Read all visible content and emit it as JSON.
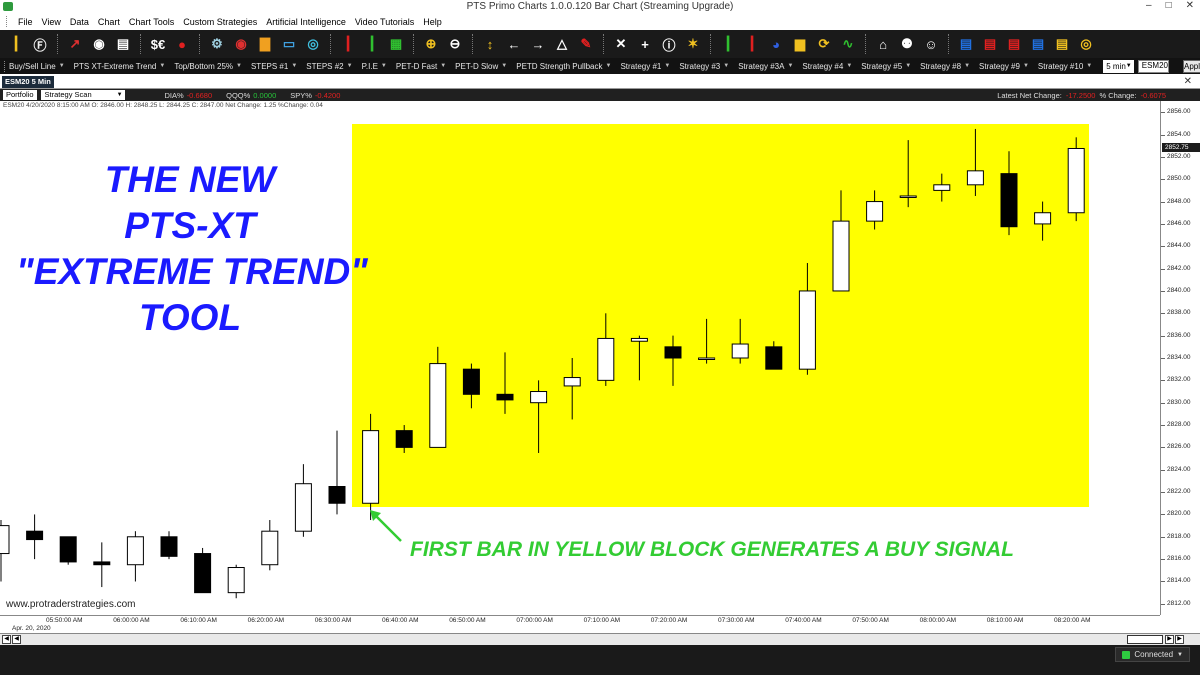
{
  "window": {
    "title": "PTS Primo Charts 1.0.0.120  Bar Chart (Streaming Upgrade)",
    "controls": [
      "–",
      "□",
      "✕"
    ]
  },
  "menu": [
    "File",
    "View",
    "Data",
    "Chart",
    "Chart Tools",
    "Custom Strategies",
    "Artificial Intelligence",
    "Video Tutorials",
    "Help"
  ],
  "toolbar_icons": [
    {
      "name": "bar-chart-icon",
      "glyph": "┃",
      "color": "#f0c020"
    },
    {
      "name": "f-icon",
      "glyph": "Ⓕ",
      "color": "#f0f0f0"
    },
    {
      "name": "arrows-icon",
      "glyph": "↗",
      "color": "#e03030"
    },
    {
      "name": "eye-icon",
      "glyph": "◉",
      "color": "#ffffff"
    },
    {
      "name": "table-icon",
      "glyph": "▤",
      "color": "#ffffff"
    },
    {
      "name": "currency-icon",
      "glyph": "$€",
      "color": "#ffffff"
    },
    {
      "name": "stop-icon",
      "glyph": "●",
      "color": "#e02020"
    },
    {
      "name": "robot-icon",
      "glyph": "⚙",
      "color": "#9ecfe0"
    },
    {
      "name": "eye-red-icon",
      "glyph": "◉",
      "color": "#e03030"
    },
    {
      "name": "chart-bars-icon",
      "glyph": "▇",
      "color": "#f0a020"
    },
    {
      "name": "monitor-icon",
      "glyph": "▭",
      "color": "#40a0e0"
    },
    {
      "name": "power-icon",
      "glyph": "◎",
      "color": "#40c0e0"
    },
    {
      "name": "candle-red-icon",
      "glyph": "┃",
      "color": "#e02020"
    },
    {
      "name": "candle-green-icon",
      "glyph": "┃",
      "color": "#30c030"
    },
    {
      "name": "grid-icon",
      "glyph": "▦",
      "color": "#30c030"
    },
    {
      "name": "zoom-in-icon",
      "glyph": "⊕",
      "color": "#f0c020"
    },
    {
      "name": "zoom-out-icon",
      "glyph": "⊖",
      "color": "#ffffff"
    },
    {
      "name": "pan-icon",
      "glyph": "↕",
      "color": "#f0c020"
    },
    {
      "name": "left-arrow-icon",
      "glyph": "←",
      "color": "#ffffff"
    },
    {
      "name": "right-arrow-icon",
      "glyph": "→",
      "color": "#ffffff"
    },
    {
      "name": "mountain-icon",
      "glyph": "△",
      "color": "#ffffff"
    },
    {
      "name": "pen-icon",
      "glyph": "✎",
      "color": "#e02020"
    },
    {
      "name": "cross-icon",
      "glyph": "✕",
      "color": "#ffffff"
    },
    {
      "name": "crosshair-icon",
      "glyph": "+",
      "color": "#ffffff"
    },
    {
      "name": "info-icon",
      "glyph": "ⓘ",
      "color": "#ffffff"
    },
    {
      "name": "star-icon",
      "glyph": "✶",
      "color": "#f0c020"
    },
    {
      "name": "candles-green-icon",
      "glyph": "┃",
      "color": "#30c030"
    },
    {
      "name": "candles-mixed-icon",
      "glyph": "┃",
      "color": "#e02020"
    },
    {
      "name": "pie-icon",
      "glyph": "◕",
      "color": "#3060e0"
    },
    {
      "name": "layout-icon",
      "glyph": "▆",
      "color": "#f0c020"
    },
    {
      "name": "refresh-icon",
      "glyph": "⟳",
      "color": "#f0c020"
    },
    {
      "name": "wave-icon",
      "glyph": "∿",
      "color": "#30c030"
    },
    {
      "name": "home-icon",
      "glyph": "⌂",
      "color": "#ffffff"
    },
    {
      "name": "users-icon",
      "glyph": "⚉",
      "color": "#ffffff"
    },
    {
      "name": "user-icon",
      "glyph": "☺",
      "color": "#ffffff"
    },
    {
      "name": "book-1-icon",
      "glyph": "▤",
      "color": "#2070e0"
    },
    {
      "name": "book-2-icon",
      "glyph": "▤",
      "color": "#e02020"
    },
    {
      "name": "book-3-icon",
      "glyph": "▤",
      "color": "#e02020"
    },
    {
      "name": "book-4-icon",
      "glyph": "▤",
      "color": "#2070e0"
    },
    {
      "name": "book-5-icon",
      "glyph": "▤",
      "color": "#f0c020"
    },
    {
      "name": "cd-icon",
      "glyph": "◎",
      "color": "#f0c020"
    }
  ],
  "strategy_bar": {
    "items": [
      "Buy/Sell Line",
      "PTS XT-Extreme Trend",
      "Top/Bottom 25%",
      "STEPS #1",
      "STEPS #2",
      "P.I.E",
      "PET-D Fast",
      "PET-D Slow",
      "PETD Strength Pullback",
      "Strategy #1",
      "Strategy #3",
      "Strategy #3A",
      "Strategy #4",
      "Strategy #5",
      "Strategy #8",
      "Strategy #9",
      "Strategy #10"
    ],
    "interval": "5 min",
    "symbol": "ESM20",
    "apply_label": "Apply"
  },
  "chart_tab": {
    "label": "ESM20 5 Min",
    "close": "✕"
  },
  "info_bar": {
    "portfolio": "Portfolio",
    "strategy_scan": "Strategy Scan",
    "tickers": [
      {
        "name": "DIA%",
        "value": "-0.6680",
        "color": "#e02020"
      },
      {
        "name": "QQQ%",
        "value": "0.0000",
        "color": "#27c23a"
      },
      {
        "name": "SPY%",
        "value": "-0.4200",
        "color": "#e02020"
      }
    ],
    "net_change_label": "Latest Net Change:",
    "net_change_value": "-17.2500",
    "pct_change_label": "% Change:",
    "pct_change_value": "-0.6075"
  },
  "bar_details": "ESM20 4/20/2020 8:15:00 AM O: 2846.00 H: 2848.25 L: 2844.25 C: 2847.00 Net Change: 1.25  %Change: 0.04",
  "overlay": {
    "headline_lines": [
      "THE NEW",
      "PTS-XT",
      "\"EXTREME TREND\"",
      "TOOL"
    ],
    "signal_text": "FIRST BAR IN YELLOW BLOCK GENERATES A BUY SIGNAL",
    "website": "www.protraderstrategies.com",
    "headline_color": "#1a1aff",
    "signal_color": "#33cc33",
    "highlight_color": "#ffff00"
  },
  "price_axis": {
    "labels": [
      "2856.00",
      "2854.00",
      "2852.00",
      "2850.00",
      "2848.00",
      "2846.00",
      "2844.00",
      "2842.00",
      "2840.00",
      "2838.00",
      "2836.00",
      "2834.00",
      "2832.00",
      "2830.00",
      "2828.00",
      "2826.00",
      "2824.00",
      "2822.00",
      "2820.00",
      "2818.00",
      "2816.00",
      "2814.00",
      "2812.00"
    ],
    "last_price": "2852.75"
  },
  "time_axis": {
    "labels": [
      "05:50:00 AM",
      "06:00:00 AM",
      "06:10:00 AM",
      "06:20:00 AM",
      "06:30:00 AM",
      "06:40:00 AM",
      "06:50:00 AM",
      "07:00:00 AM",
      "07:10:00 AM",
      "07:20:00 AM",
      "07:30:00 AM",
      "07:40:00 AM",
      "07:50:00 AM",
      "08:00:00 AM",
      "08:10:00 AM",
      "08:20:00 AM"
    ],
    "date": "Apr. 20, 2020"
  },
  "status": {
    "connected": "Connected"
  },
  "chart_data": {
    "type": "candlestick",
    "symbol": "ESM20",
    "interval": "5 min",
    "ylim": [
      2811,
      2857
    ],
    "candles": [
      {
        "o": 2816.5,
        "h": 2819.5,
        "l": 2814.0,
        "c": 2819.0
      },
      {
        "o": 2818.5,
        "h": 2820.0,
        "l": 2816.0,
        "c": 2817.75
      },
      {
        "o": 2818.0,
        "h": 2818.0,
        "l": 2815.5,
        "c": 2815.75
      },
      {
        "o": 2815.75,
        "h": 2817.5,
        "l": 2813.5,
        "c": 2815.5
      },
      {
        "o": 2815.5,
        "h": 2818.5,
        "l": 2814.0,
        "c": 2818.0
      },
      {
        "o": 2818.0,
        "h": 2818.5,
        "l": 2816.0,
        "c": 2816.25
      },
      {
        "o": 2816.5,
        "h": 2817.0,
        "l": 2813.0,
        "c": 2813.0
      },
      {
        "o": 2813.0,
        "h": 2815.5,
        "l": 2812.5,
        "c": 2815.25
      },
      {
        "o": 2815.5,
        "h": 2819.5,
        "l": 2815.0,
        "c": 2818.5
      },
      {
        "o": 2818.5,
        "h": 2824.5,
        "l": 2818.0,
        "c": 2822.75
      },
      {
        "o": 2822.5,
        "h": 2827.5,
        "l": 2820.0,
        "c": 2821.0
      },
      {
        "o": 2821.0,
        "h": 2829.0,
        "l": 2819.5,
        "c": 2827.5
      },
      {
        "o": 2827.5,
        "h": 2828.0,
        "l": 2825.5,
        "c": 2826.0
      },
      {
        "o": 2826.0,
        "h": 2835.0,
        "l": 2826.0,
        "c": 2833.5
      },
      {
        "o": 2833.0,
        "h": 2833.5,
        "l": 2829.5,
        "c": 2830.75
      },
      {
        "o": 2830.75,
        "h": 2834.5,
        "l": 2829.0,
        "c": 2830.25
      },
      {
        "o": 2830.0,
        "h": 2832.0,
        "l": 2825.5,
        "c": 2831.0
      },
      {
        "o": 2831.5,
        "h": 2834.0,
        "l": 2828.5,
        "c": 2832.25
      },
      {
        "o": 2832.0,
        "h": 2838.0,
        "l": 2831.5,
        "c": 2835.75
      },
      {
        "o": 2835.5,
        "h": 2836.0,
        "l": 2832.0,
        "c": 2835.75
      },
      {
        "o": 2835.0,
        "h": 2836.0,
        "l": 2831.5,
        "c": 2834.0
      },
      {
        "o": 2834.0,
        "h": 2837.5,
        "l": 2833.5,
        "c": 2834.0
      },
      {
        "o": 2834.0,
        "h": 2837.5,
        "l": 2833.5,
        "c": 2835.25
      },
      {
        "o": 2835.0,
        "h": 2835.5,
        "l": 2833.0,
        "c": 2833.0
      },
      {
        "o": 2833.0,
        "h": 2842.5,
        "l": 2832.5,
        "c": 2840.0
      },
      {
        "o": 2840.0,
        "h": 2849.0,
        "l": 2840.0,
        "c": 2846.25
      },
      {
        "o": 2846.25,
        "h": 2849.0,
        "l": 2845.5,
        "c": 2848.0
      },
      {
        "o": 2848.5,
        "h": 2853.5,
        "l": 2847.5,
        "c": 2848.5
      },
      {
        "o": 2849.0,
        "h": 2850.5,
        "l": 2848.0,
        "c": 2849.5
      },
      {
        "o": 2849.5,
        "h": 2854.5,
        "l": 2848.5,
        "c": 2850.75
      },
      {
        "o": 2850.5,
        "h": 2852.5,
        "l": 2845.0,
        "c": 2845.75
      },
      {
        "o": 2846.0,
        "h": 2848.0,
        "l": 2844.5,
        "c": 2847.0
      },
      {
        "o": 2847.0,
        "h": 2853.75,
        "l": 2846.25,
        "c": 2852.75
      }
    ],
    "buy_signal_index": 11,
    "up_color": "#ffffff",
    "down_color": "#000000"
  }
}
